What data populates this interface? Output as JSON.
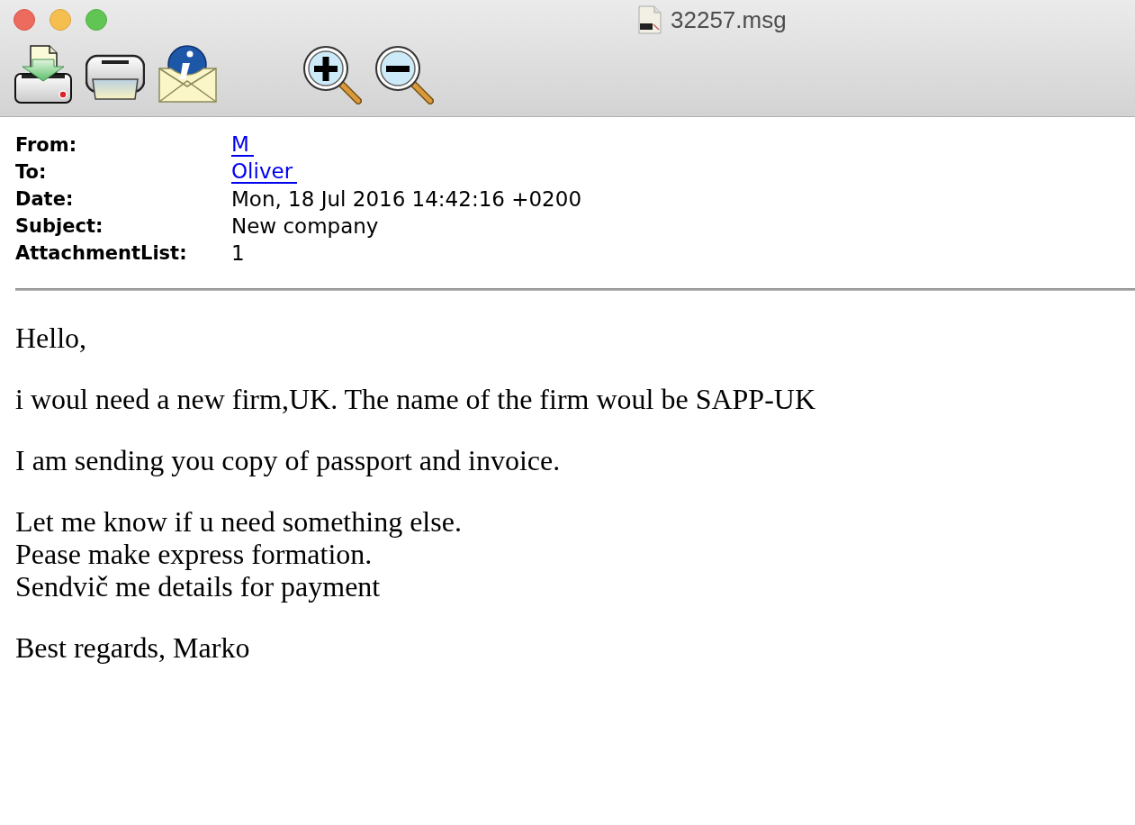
{
  "window": {
    "title": "32257.msg"
  },
  "headers": [
    {
      "label": "From:",
      "value": "M",
      "kind": "link"
    },
    {
      "label": "To:",
      "value": "Oliver",
      "kind": "link"
    },
    {
      "label": "Date:",
      "value": "Mon, 18 Jul 2016 14:42:16 +0200",
      "kind": "text"
    },
    {
      "label": "Subject:",
      "value": "New company",
      "kind": "text"
    },
    {
      "label": "AttachmentList:",
      "value": "1",
      "kind": "text"
    }
  ],
  "body": {
    "paragraphs": [
      [
        "Hello,"
      ],
      [
        "i woul need a new firm,UK. The name of the firm woul be SAPP-UK"
      ],
      [
        "I am sending you copy of passport and invoice."
      ],
      [
        "Let me know if u need something else.",
        "Pease make express formation.",
        "Sendvič me details for payment"
      ],
      [
        "Best regards, Marko"
      ]
    ]
  }
}
